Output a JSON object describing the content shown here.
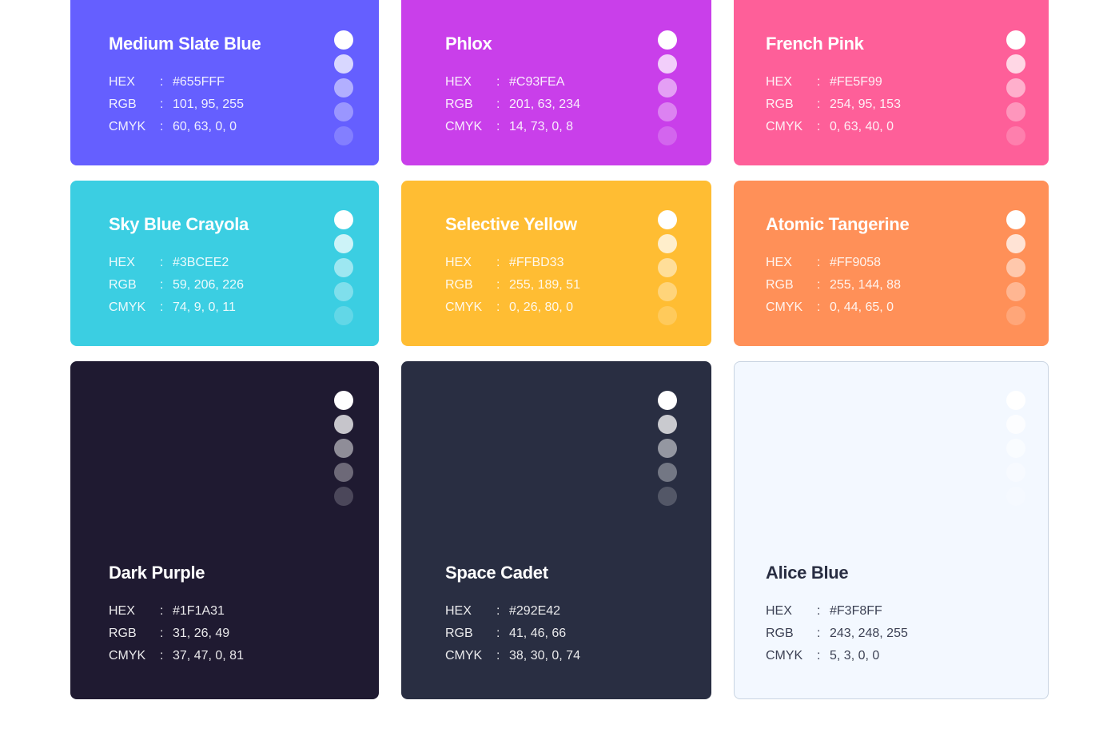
{
  "swatches": [
    {
      "name": "Medium Slate Blue",
      "hex": "#655FFF",
      "rgb": "101, 95, 255",
      "cmyk": "60, 63, 0, 0",
      "bg": "#655FFF",
      "text": "#ffffff",
      "dot": "#ffffff"
    },
    {
      "name": "Phlox",
      "hex": "#C93FEA",
      "rgb": "201, 63, 234",
      "cmyk": "14, 73, 0, 8",
      "bg": "#C93FEA",
      "text": "#ffffff",
      "dot": "#ffffff"
    },
    {
      "name": "French Pink",
      "hex": "#FE5F99",
      "rgb": "254, 95, 153",
      "cmyk": "0, 63, 40, 0",
      "bg": "#FE5F99",
      "text": "#ffffff",
      "dot": "#ffffff"
    },
    {
      "name": "Sky Blue Crayola",
      "hex": "#3BCEE2",
      "rgb": "59, 206, 226",
      "cmyk": "74, 9, 0, 11",
      "bg": "#3BCEE2",
      "text": "#ffffff",
      "dot": "#ffffff"
    },
    {
      "name": "Selective Yellow",
      "hex": "#FFBD33",
      "rgb": "255, 189, 51",
      "cmyk": "0, 26, 80, 0",
      "bg": "#FFBD33",
      "text": "#ffffff",
      "dot": "#ffffff"
    },
    {
      "name": "Atomic Tangerine",
      "hex": "#FF9058",
      "rgb": "255, 144, 88",
      "cmyk": "0, 44, 65, 0",
      "bg": "#FF9058",
      "text": "#ffffff",
      "dot": "#ffffff"
    },
    {
      "name": "Dark Purple",
      "hex": "#1F1A31",
      "rgb": "31, 26, 49",
      "cmyk": "37, 47, 0, 81",
      "bg": "#1F1A31",
      "text": "#ffffff",
      "dot": "#ffffff"
    },
    {
      "name": "Space Cadet",
      "hex": "#292E42",
      "rgb": "41, 46, 66",
      "cmyk": "38, 30, 0, 74",
      "bg": "#292E42",
      "text": "#ffffff",
      "dot": "#ffffff"
    },
    {
      "name": "Alice Blue",
      "hex": "#F3F8FF",
      "rgb": "243, 248, 255",
      "cmyk": "5, 3, 0, 0",
      "bg": "#F3F8FF",
      "text": "#292E42",
      "dot": "#ffffff"
    }
  ],
  "labels": {
    "hex": "HEX",
    "rgb": "RGB",
    "cmyk": "CMYK",
    "separator": ":"
  },
  "tint_levels": [
    1,
    0.75,
    0.5,
    0.35,
    0.2
  ]
}
